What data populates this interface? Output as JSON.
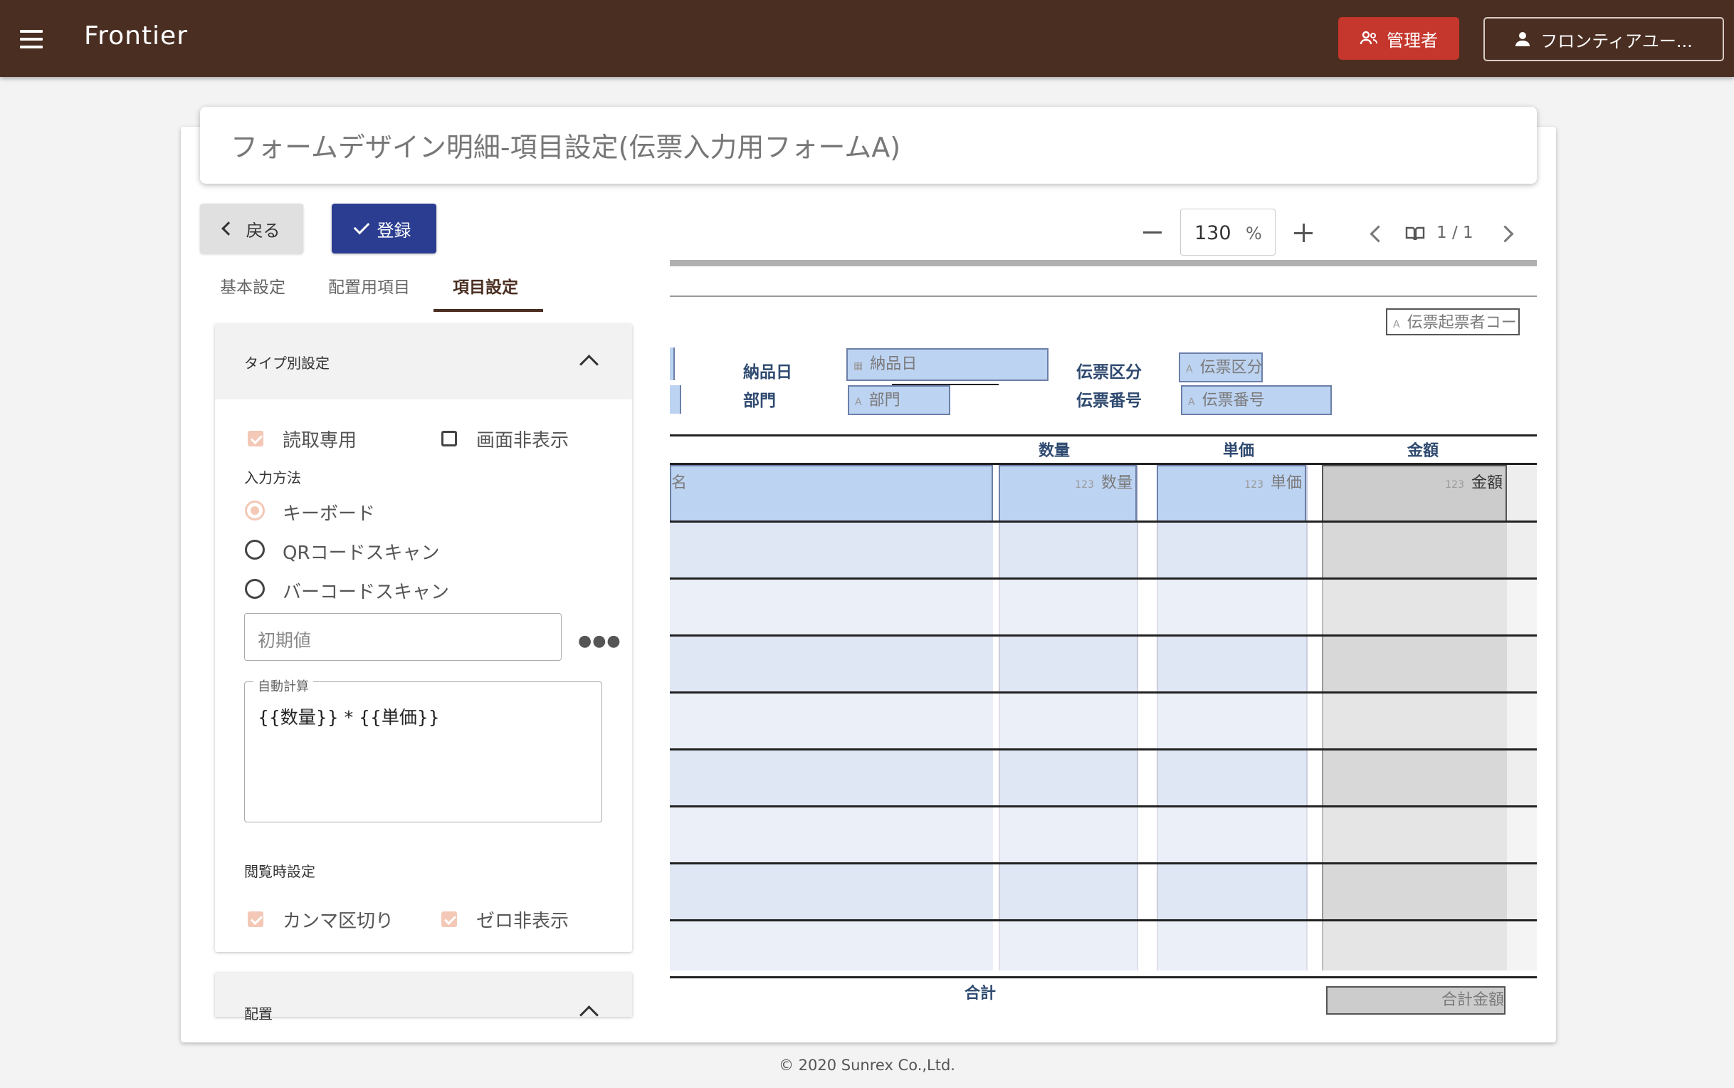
{
  "app": {
    "title": "Frontier",
    "admin_label": "管理者",
    "user_label": "フロンティアユー..."
  },
  "page": {
    "title": "フォームデザイン明細-項目設定(伝票入力用フォームA)",
    "back_label": "戻る",
    "save_label": "登録"
  },
  "tabs": [
    {
      "label": "基本設定",
      "active": false
    },
    {
      "label": "配置用項目",
      "active": false
    },
    {
      "label": "項目設定",
      "active": true
    }
  ],
  "type_settings": {
    "header": "タイプ別設定",
    "readonly_label": "読取専用",
    "readonly_checked": true,
    "hidden_label": "画面非表示",
    "hidden_checked": false,
    "input_method_label": "入力方法",
    "input_methods": [
      {
        "label": "キーボード",
        "selected": true
      },
      {
        "label": "QRコードスキャン",
        "selected": false
      },
      {
        "label": "バーコードスキャン",
        "selected": false
      }
    ],
    "initial_value_placeholder": "初期値",
    "auto_calc_label": "自動計算",
    "auto_calc_value": "{{数量}} * {{単価}}",
    "view_settings_label": "閲覧時設定",
    "comma_label": "カンマ区切り",
    "comma_checked": true,
    "zero_hide_label": "ゼロ非表示",
    "zero_hide_checked": true
  },
  "placement": {
    "header": "配置"
  },
  "preview": {
    "zoom": "130",
    "zoom_unit": "%",
    "page_indicator": "1 / 1",
    "form": {
      "creator_field": "伝票起票者コー",
      "delivery_label": "納品日",
      "delivery_field": "納品日",
      "dept_label": "部門",
      "dept_field": "部門",
      "slip_type_label": "伝票区分",
      "slip_type_field": "伝票区分",
      "slip_no_label": "伝票番号",
      "slip_no_field": "伝票番号",
      "col_qty": "数量",
      "col_price": "単価",
      "col_amount": "金額",
      "row_name_fragment": "名",
      "field_qty": "数量",
      "field_price": "単価",
      "field_amount": "金額",
      "numeric_prefix": "123",
      "total_label": "合計",
      "total_field": "合計金額"
    }
  },
  "footer": {
    "copyright": "© 2020 Sunrex Co.,Ltd."
  }
}
